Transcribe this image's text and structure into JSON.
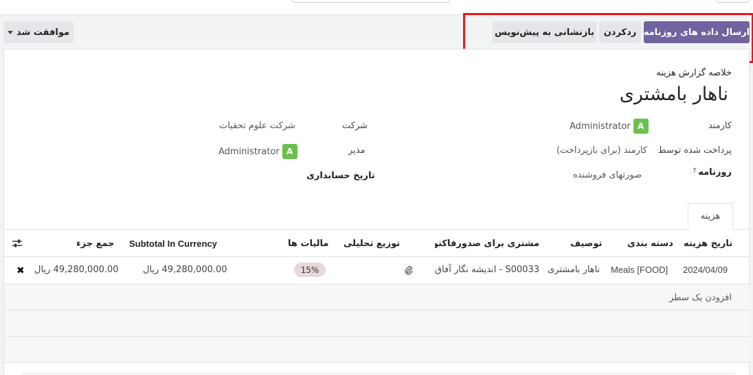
{
  "buttons": {
    "send_journal": "ارسال داده های روزنامه",
    "refuse": "ردکردن",
    "reset_draft": "بازنشانی به پیش‌نویس",
    "approved": "موافقت شد"
  },
  "sheet": {
    "subtitle": "خلاصه گزارش هزینه",
    "title": "ناهار بامشتری",
    "fields": {
      "employee_label": "کارمند",
      "employee_avatar": "A",
      "employee_value": "Administrator",
      "paid_by_label": "پرداخت شده توسط",
      "paid_by_value": "کارمند (برای بازپرداخت)",
      "journal_label": "روزنامه",
      "journal_help": "?",
      "journal_value": "صورتهای فروشنده",
      "company_label": "شرکت",
      "company_value": "شرکت علوم تحقیات",
      "manager_label": "مدیر",
      "manager_avatar": "A",
      "manager_value": "Administrator",
      "accounting_date_label": "تاریخ حسابداری"
    }
  },
  "tabs": [
    {
      "label": "هزینه"
    }
  ],
  "table": {
    "headers": {
      "date": "تاریخ هزینه",
      "category": "دسته بندی",
      "description": "توصیف",
      "customer": "مشتری برای صدورفاکتور...",
      "analytic": "توزیع تحلیلی",
      "taxes": "مالیات ها",
      "subtotal_currency": "Subtotal In Currency",
      "subtotal": "جمع جزء"
    },
    "rows": [
      {
        "date": "2024/04/09",
        "category": "Meals [FOOD]",
        "description": "ناهار بامشتری",
        "customer": "S00033 - اندیشه نگار آفاق",
        "tax": "15%",
        "subtotal_currency": "49,280,000.00 ریال",
        "subtotal": "49,280,000.00 ریال"
      }
    ],
    "add_line": "افزودن یک سطر"
  },
  "icons": {
    "settings": "sliders-icon",
    "attachment": "paperclip-icon",
    "delete": "close-icon"
  },
  "colors": {
    "primary": "#71639e",
    "highlight": "#e8161e",
    "avatar": "#6ac04d"
  }
}
